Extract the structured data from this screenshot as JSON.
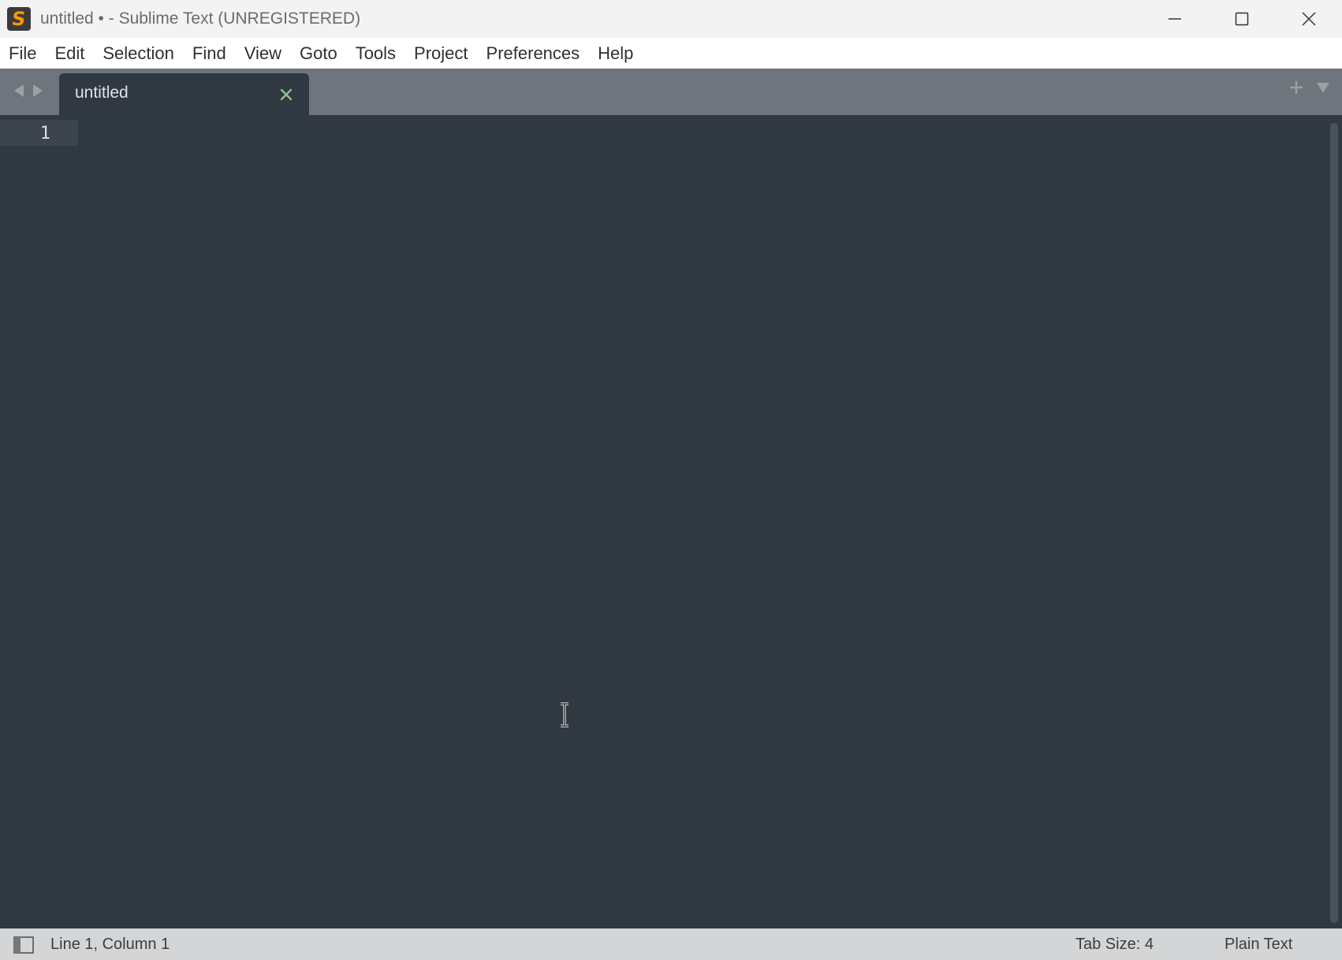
{
  "window": {
    "title": "untitled • - Sublime Text (UNREGISTERED)",
    "app_icon": "sublime-text-logo",
    "controls": [
      "minimize-icon",
      "maximize-icon",
      "close-icon"
    ]
  },
  "menu": {
    "items": [
      {
        "label": "File"
      },
      {
        "label": "Edit"
      },
      {
        "label": "Selection"
      },
      {
        "label": "Find"
      },
      {
        "label": "View"
      },
      {
        "label": "Goto"
      },
      {
        "label": "Tools"
      },
      {
        "label": "Project"
      },
      {
        "label": "Preferences"
      },
      {
        "label": "Help"
      }
    ]
  },
  "tabs": {
    "items": [
      {
        "label": "untitled",
        "active": true
      }
    ]
  },
  "editor": {
    "line_numbers": [
      "1"
    ],
    "content": ""
  },
  "statusbar": {
    "position": "Line 1, Column 1",
    "tab_size": "Tab Size: 4",
    "syntax": "Plain Text"
  },
  "colors": {
    "editor_bg": "#303841",
    "tab_strip_bg": "#6e757c",
    "accent": "#ff9800",
    "status_bg": "#d3d5d7"
  }
}
